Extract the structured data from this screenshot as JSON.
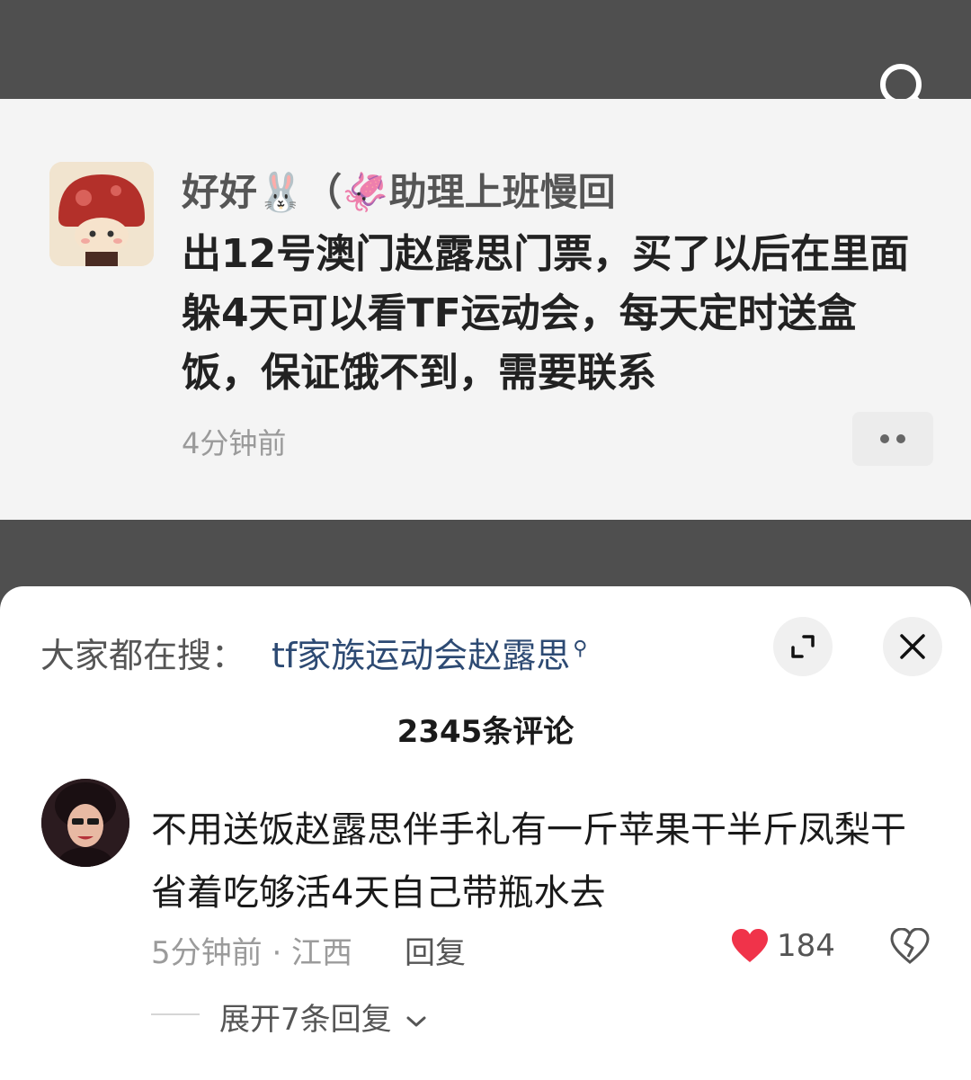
{
  "post": {
    "author": "好好🐰（🦑助理上班慢回",
    "text": "出12号澳门赵露思门票，买了以后在里面躲4天可以看TF运动会，每天定时送盒饭，保证饿不到，需要联系",
    "time": "4分钟前"
  },
  "panel": {
    "trending_label": "大家都在搜：",
    "trending_query": "tf家族运动会赵露思",
    "comment_count": "2345条评论"
  },
  "comment": {
    "text": "不用送饭赵露思伴手礼有一斤苹果干半斤凤梨干省着吃够活4天自己带瓶水去",
    "meta": "5分钟前 · 江西",
    "reply_label": "回复",
    "likes": "184",
    "expand_label": "展开7条回复"
  },
  "icons": {
    "search": "search-icon",
    "expand": "expand-icon",
    "close": "close-icon",
    "more": "more-icon",
    "heart": "heart-icon",
    "dislike": "broken-heart-icon",
    "chevron": "chevron-down-icon"
  },
  "colors": {
    "like_red": "#f0334a",
    "link_blue": "#2d4a73"
  }
}
